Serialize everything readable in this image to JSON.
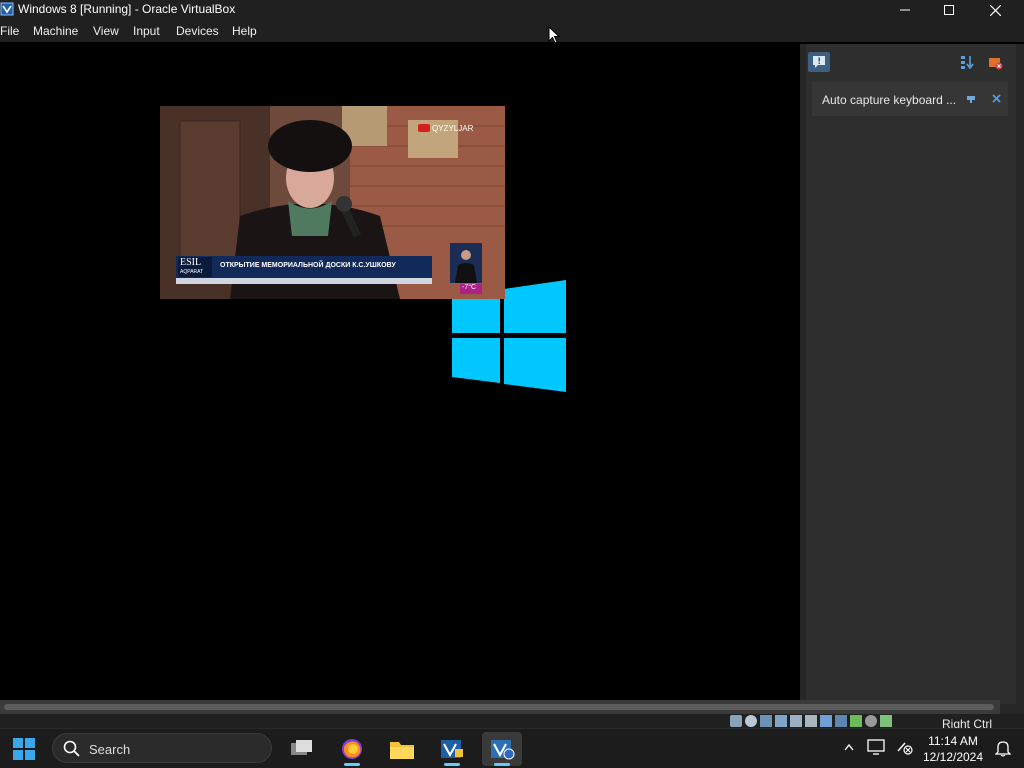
{
  "window": {
    "title": "Windows 8 [Running] - Oracle VirtualBox"
  },
  "menu": [
    "File",
    "Machine",
    "View",
    "Input",
    "Devices",
    "Help"
  ],
  "panel": {
    "notification": {
      "text": "Auto capture keyboard ..."
    }
  },
  "video": {
    "channel_badge": "QYZYLJAR",
    "logo_line1": "ESIL",
    "logo_line2": "AQPARAT",
    "caption": "ОТКРЫТИЕ МЕМОРИАЛЬНОЙ ДОСКИ К.С.УШКОВУ",
    "temperature": "-7°C"
  },
  "statusbar": {
    "host_key": "Right Ctrl"
  },
  "taskbar": {
    "search_label": "Search",
    "time": "11:14 AM",
    "date": "12/12/2024"
  },
  "colors": {
    "windows_logo": "#00c8ff",
    "chrome_bg": "#202020",
    "accent": "#60cdff"
  }
}
